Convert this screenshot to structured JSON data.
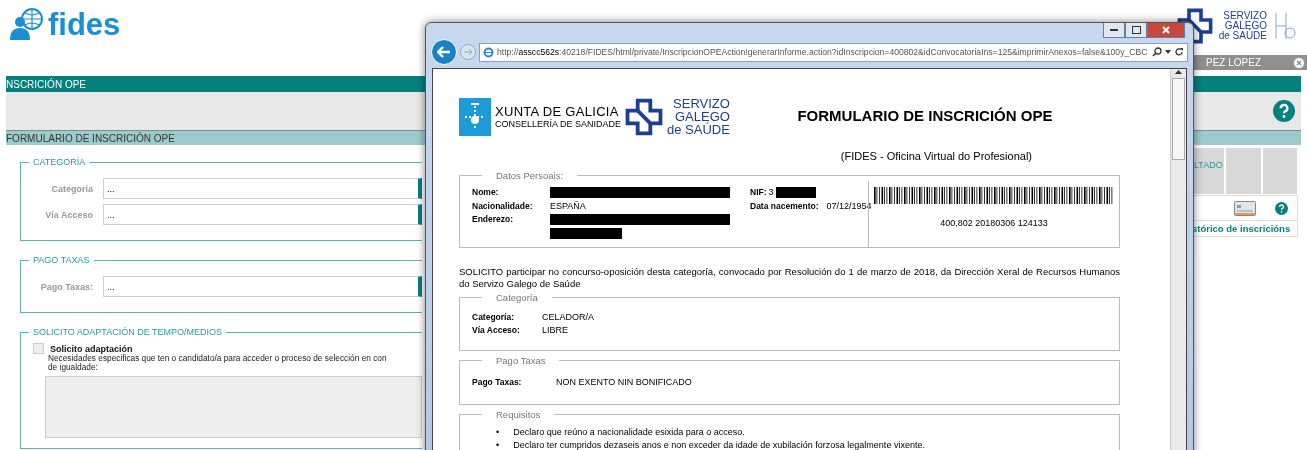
{
  "page": {
    "logo": "fides",
    "header_logo": [
      "SERVIZO",
      "GALEGO",
      "de SAÚDE"
    ],
    "user_name": "PEZ LOPEZ",
    "section_bar": "NSCRICIÓN OPE",
    "form_bar": "FORMULARIO DE INSCRICIÓN OPE",
    "fieldsets": [
      {
        "legend": "CATEGORÍA",
        "fields": [
          {
            "label": "Categoría",
            "value": "..."
          },
          {
            "label": "Vía Acceso",
            "value": "..."
          }
        ]
      },
      {
        "legend": "PAGO TAXAS",
        "fields": [
          {
            "label": "Pago Taxas:",
            "value": "..."
          }
        ]
      }
    ],
    "adaptation": {
      "legend": "SOLICITO ADAPTACIÓN DE TEMPO/MEDIOS",
      "checkbox": {
        "label": "Solicito adaptación",
        "checked": false
      },
      "description": [
        "Necesidades especificas que ten o candidato/a para acceder o proceso de selección en con",
        "de igualdade:"
      ]
    },
    "results_table": {
      "columns": [
        "LTADO"
      ],
      "link": "stórico de inscricións"
    }
  },
  "popup": {
    "url": "http://**asscc562s**:40218/FIDES/html/private/InscripcionOPEAction!generarInforme.action?idInscripcion=400802&idConvocatoriaIns=125&imprimirAnexos=false&100y_CBC",
    "document": {
      "xunta_logo": [
        "XUNTA DE GALICIA",
        "CONSELLERÍA DE SANIDADE"
      ],
      "sergas_logo": [
        "SERVIZO",
        "GALEGO",
        "de SAÚDE"
      ],
      "title": "FORMULARIO DE INSCRICIÓN OPE",
      "subtitle": "(FIDES - Oficina Virtual do Profesional)",
      "personal": {
        "legend": "Datos Persoais:",
        "left": [
          {
            "label": "Nome:",
            "redacted": true
          },
          {
            "label": "Nacionalidade:",
            "value": "ESPAÑA",
            "redacted": false
          },
          {
            "label": "Enderezo:",
            "redacted": true
          }
        ],
        "right": [
          {
            "label": "NIF:",
            "value": "3",
            "redacted": true
          },
          {
            "label": "Data nacemento:",
            "value": "07/12/1954",
            "redacted": false
          }
        ],
        "barcode_text": "400,802 20180306 124133"
      },
      "statement": "SOLICITO participar no concurso-oposición desta categoría, convocado por Resolución do 1 de marzo de 2018, da Dirección Xeral de Recursos Humanos do Servizo Galego de Saúde",
      "sections": [
        {
          "legend": "Categoría",
          "rows": [
            {
              "label": "Categoría:",
              "value": "CELADOR/A"
            },
            {
              "label": "Vía Acceso:",
              "value": "LIBRE"
            }
          ]
        },
        {
          "legend": "Pago Taxas",
          "rows": [
            {
              "label": "Pago Taxas:",
              "value": "NON EXENTO NIN BONIFICADO"
            }
          ]
        }
      ],
      "requirements": {
        "legend": "Requisitos",
        "items": [
          {
            "bullet": "•",
            "text": "Declaro que reúno a nacionalidade esixida para o acceso."
          },
          {
            "bullet": "•",
            "text": "Declaro ter cumpridos dezaseis anos e non exceder da idade de xubilación forzosa legalmente vixente."
          }
        ]
      }
    }
  }
}
